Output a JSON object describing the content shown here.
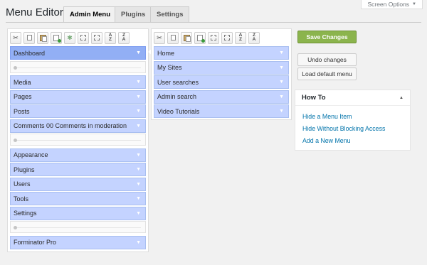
{
  "header": {
    "title": "Menu Editor",
    "tabs": [
      {
        "label": "Admin Menu",
        "active": true
      },
      {
        "label": "Plugins",
        "active": false
      },
      {
        "label": "Settings",
        "active": false
      }
    ],
    "screen_options": "Screen Options"
  },
  "toolbar_icons": [
    "cut-icon",
    "copy-icon",
    "paste-icon",
    "new-menu-icon",
    "new-separator-icon",
    "copy-icon",
    "paste-icon",
    "sort-ascending-icon",
    "sort-descending-icon"
  ],
  "left_menu": [
    {
      "label": "Dashboard",
      "selected": true
    },
    {
      "separator": true
    },
    {
      "label": "Media"
    },
    {
      "label": "Pages"
    },
    {
      "label": "Posts"
    },
    {
      "label": "Comments 00 Comments in moderation"
    },
    {
      "separator": true
    },
    {
      "label": "Appearance"
    },
    {
      "label": "Plugins"
    },
    {
      "label": "Users"
    },
    {
      "label": "Tools"
    },
    {
      "label": "Settings"
    },
    {
      "separator": true
    },
    {
      "label": "Forminator Pro"
    }
  ],
  "submenu": [
    {
      "label": "Home"
    },
    {
      "label": "My Sites"
    },
    {
      "label": "User searches"
    },
    {
      "label": "Admin search"
    },
    {
      "label": "Video Tutorials"
    }
  ],
  "actions": {
    "save": "Save Changes",
    "undo": "Undo changes",
    "load_default": "Load default menu"
  },
  "howto": {
    "title": "How To",
    "links": [
      "Hide a Menu Item",
      "Hide Without Blocking Access",
      "Add a New Menu"
    ]
  },
  "colors": {
    "item_bg": "#c4d3ff",
    "item_selected_bg": "#92aff5",
    "primary_button": "#8bb44d",
    "link": "#0073aa"
  }
}
